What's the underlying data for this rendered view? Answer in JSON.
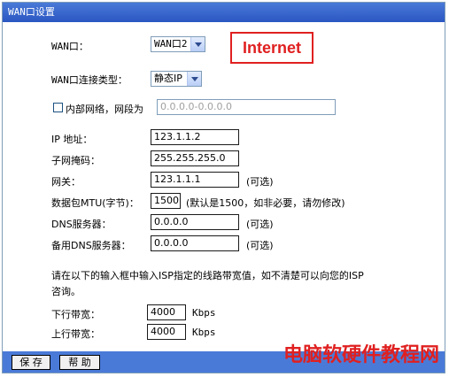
{
  "window": {
    "title": "WAN口设置"
  },
  "annotation": {
    "text": "Internet"
  },
  "wan_port": {
    "label": "WAN口：",
    "value": "WAN口2"
  },
  "conn_type": {
    "label": "WAN口连接类型：",
    "value": "静态IP"
  },
  "internal_net": {
    "label": "内部网络，网段为",
    "placeholder": "0.0.0.0-0.0.0.0"
  },
  "ip": {
    "label": "IP 地址：",
    "value": "123.1.1.2"
  },
  "mask": {
    "label": "子网掩码：",
    "value": "255.255.255.0"
  },
  "gateway": {
    "label": "网关：",
    "value": "123.1.1.1",
    "hint": "(可选)"
  },
  "mtu": {
    "label": "数据包MTU(字节)：",
    "value": "1500",
    "hint": "(默认是1500，如非必要，请勿修改)"
  },
  "dns": {
    "label": "DNS服务器：",
    "value": "0.0.0.0",
    "hint": "(可选)"
  },
  "dns2": {
    "label": "备用DNS服务器：",
    "value": "0.0.0.0",
    "hint": "(可选)"
  },
  "note": {
    "line1": "请在以下的输入框中输入ISP指定的线路带宽值，如不清楚可以向您的ISP",
    "line2": "咨询。"
  },
  "down": {
    "label": "下行带宽：",
    "value": "4000",
    "unit": "Kbps"
  },
  "up": {
    "label": "上行带宽：",
    "value": "4000",
    "unit": "Kbps"
  },
  "buttons": {
    "save": "保 存",
    "help": "帮 助"
  },
  "watermark": "电脑软硬件教程网"
}
